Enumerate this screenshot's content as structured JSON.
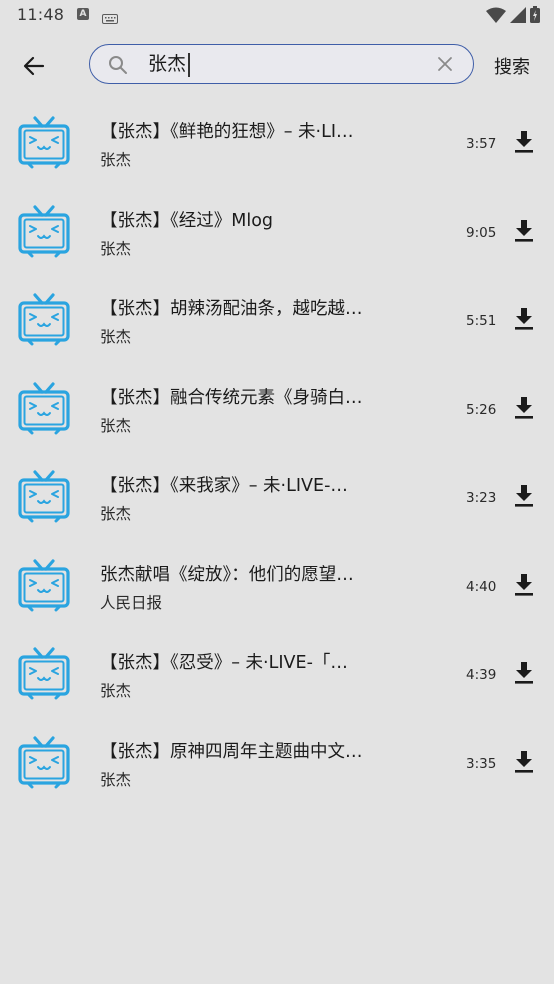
{
  "status_bar": {
    "time": "11:48",
    "notification_icon_letter": "A",
    "icons": [
      "keyboard-icon",
      "wifi-icon",
      "signal-icon",
      "battery-icon"
    ]
  },
  "search": {
    "query": "张杰",
    "submit_label": "搜索"
  },
  "colors": {
    "accent": "#3f5ea8",
    "tv_icon": "#2aa4e0",
    "background": "#e3e3e3"
  },
  "results": [
    {
      "title": "【张杰】《鲜艳的狂想》– 未·LI…",
      "author": "张杰",
      "duration": "3:57"
    },
    {
      "title": "【张杰】《经过》Mlog",
      "author": "张杰",
      "duration": "9:05"
    },
    {
      "title": "【张杰】胡辣汤配油条，越吃越…",
      "author": "张杰",
      "duration": "5:51"
    },
    {
      "title": "【张杰】融合传统元素《身骑白…",
      "author": "张杰",
      "duration": "5:26"
    },
    {
      "title": "【张杰】《来我家》– 未·LIVE-…",
      "author": "张杰",
      "duration": "3:23"
    },
    {
      "title": "张杰献唱《绽放》：他们的愿望…",
      "author": "人民日报",
      "duration": "4:40"
    },
    {
      "title": "【张杰】《忍受》– 未·LIVE-「…",
      "author": "张杰",
      "duration": "4:39"
    },
    {
      "title": "【张杰】原神四周年主题曲中文…",
      "author": "张杰",
      "duration": "3:35"
    }
  ]
}
